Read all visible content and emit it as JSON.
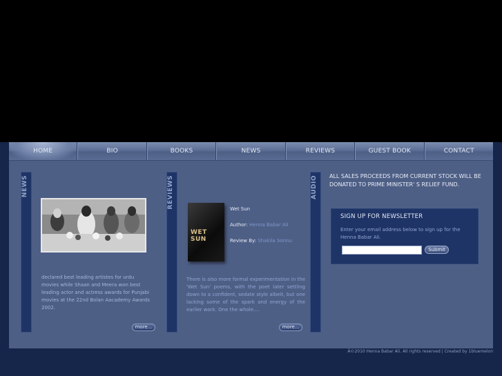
{
  "nav": {
    "items": [
      {
        "label": "HOME",
        "active": true
      },
      {
        "label": "BIO",
        "active": false
      },
      {
        "label": "BOOKS",
        "active": false
      },
      {
        "label": "NEWS",
        "active": false
      },
      {
        "label": "REVIEWS",
        "active": false
      },
      {
        "label": "GUEST BOOK",
        "active": false
      },
      {
        "label": "CONTACT",
        "active": false
      }
    ]
  },
  "news": {
    "section_label": "NEWS",
    "text": "declared best leading artistes for urdu movies while Shaan and Meera won best leading actor and actress awards for Punjabi movies at the 22nd Bolan Aacademy Awards 2002.",
    "more_label": "more..."
  },
  "reviews": {
    "section_label": "REVIEWS",
    "book_title": "Wet Sun",
    "book_cover_text": "WET SUN",
    "author_label": "Author:",
    "author_name": "Henna Babar Ali",
    "reviewer_label": "Review By:",
    "reviewer_name": "Shakila Sonnu",
    "text": "There is also more formal experimentation in the 'Wet Sun' poems, with the poet later settling down to a confident, sedate style albeit, but one lacking some of the spark and energy of the earlier work. One the whole....",
    "more_label": "more..."
  },
  "audio": {
    "section_label": "AUDIO"
  },
  "sales": {
    "text": "ALL SALES PROCEEDS FROM CURRENT STOCK WILL BE DONATED TO PRIME MINISTER' S RELIEF FUND."
  },
  "newsletter": {
    "title": "SIGN UP FOR NEWSLETTER",
    "description": "Enter your email address below to sign up for the Henna Babar Ali.",
    "email_value": "",
    "submit_label": "Submit"
  },
  "footer": {
    "text": "Â©2010 Henna Babar Ali. All rights reserved | Created by 1bluemelon"
  },
  "colors": {
    "page_bg": "#16254a",
    "panel_bg": "#4e5f86",
    "box_bg": "#1f3466",
    "link": "#7d97c9"
  }
}
